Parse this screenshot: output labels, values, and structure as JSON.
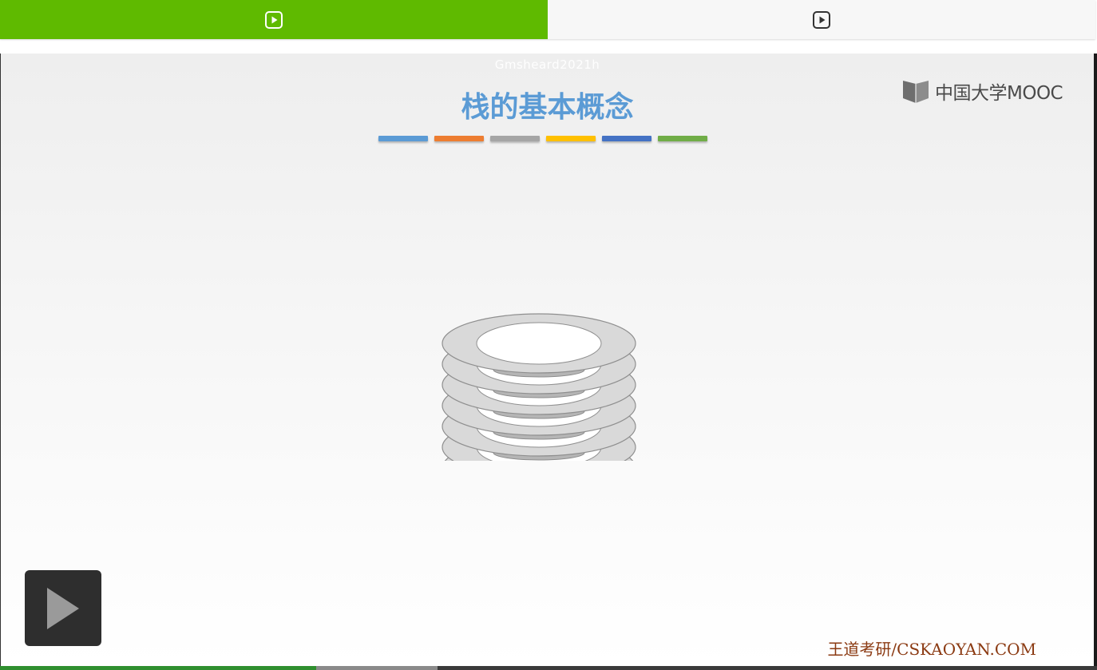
{
  "tabs": [
    {
      "icon": "play-square-icon",
      "active": true,
      "color": "#5fba00"
    },
    {
      "icon": "play-square-icon",
      "active": false
    }
  ],
  "slide": {
    "watermark_top": "Gmsheard2021h",
    "title": "栈的基本概念",
    "title_color": "#5b9bd5",
    "color_bars": [
      "#5b9bd5",
      "#ed7d31",
      "#a5a5a5",
      "#ffc000",
      "#4472c4",
      "#70ad47"
    ],
    "logo_text": "中国大学MOOC",
    "plate_count": 7,
    "footer_brand": "王道考研/CSKAOYAN.COM"
  },
  "player": {
    "play_icon": "play-icon",
    "progress_played_fraction": 0.288,
    "progress_buffered_fraction": 0.399
  }
}
